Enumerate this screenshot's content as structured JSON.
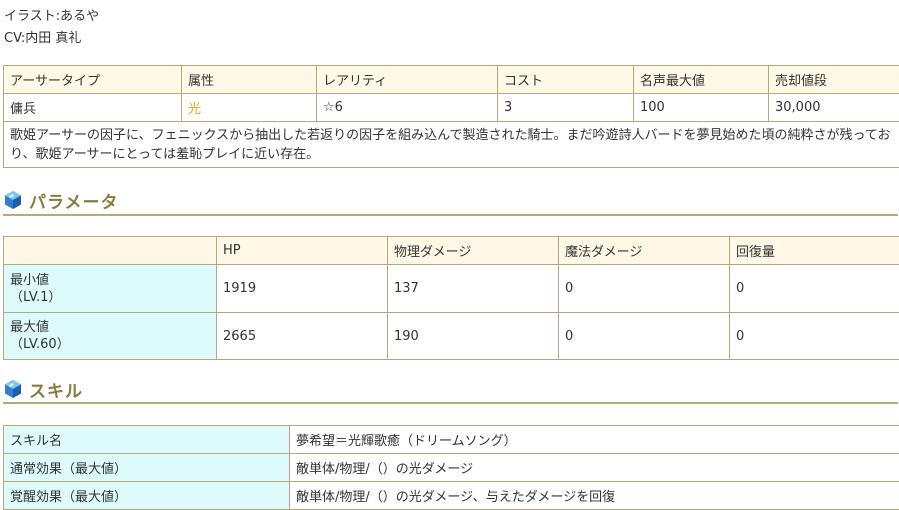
{
  "credits": {
    "illust": "イラスト:あるや",
    "cv": "CV:内田 真礼"
  },
  "info_table": {
    "headers": [
      "アーサータイプ",
      "属性",
      "レアリティ",
      "コスト",
      "名声最大値",
      "売却値段"
    ],
    "values": [
      "傭兵",
      "光",
      "☆6",
      "3",
      "100",
      "30,000"
    ],
    "description": "歌姫アーサーの因子に、フェニックスから抽出した若返りの因子を組み込んで製造された騎士。まだ吟遊詩人バードを夢見始めた頃の純粋さが残っており、歌姫アーサーにとっては羞恥プレイに近い存在。"
  },
  "params_section": {
    "title": "パラメータ",
    "icon": "blue-gem-icon",
    "headers": [
      "",
      "HP",
      "物理ダメージ",
      "魔法ダメージ",
      "回復量"
    ],
    "rows": [
      {
        "label": "最小値",
        "level": "（LV.1）",
        "values": [
          "1919",
          "137",
          "0",
          "0"
        ]
      },
      {
        "label": "最大値",
        "level": "（LV.60）",
        "values": [
          "2665",
          "190",
          "0",
          "0"
        ]
      }
    ]
  },
  "skill_section": {
    "title": "スキル",
    "icon": "blue-gem-icon",
    "rows": [
      {
        "label": "スキル名",
        "value": "夢希望＝光輝歌癒（ドリームソング）"
      },
      {
        "label": "通常効果（最大値）",
        "value": "敵単体/物理/（）の光ダメージ"
      },
      {
        "label": "覚醒効果（最大値）",
        "value": "敵単体/物理/（）の光ダメージ、与えたダメージを回復"
      }
    ]
  },
  "colors": {
    "border": "#b8a878",
    "header_bg": "#fff8e6",
    "label_bg": "#ddfbfb",
    "section_title": "#8c7a3c",
    "attr_light": "#e6a817"
  }
}
